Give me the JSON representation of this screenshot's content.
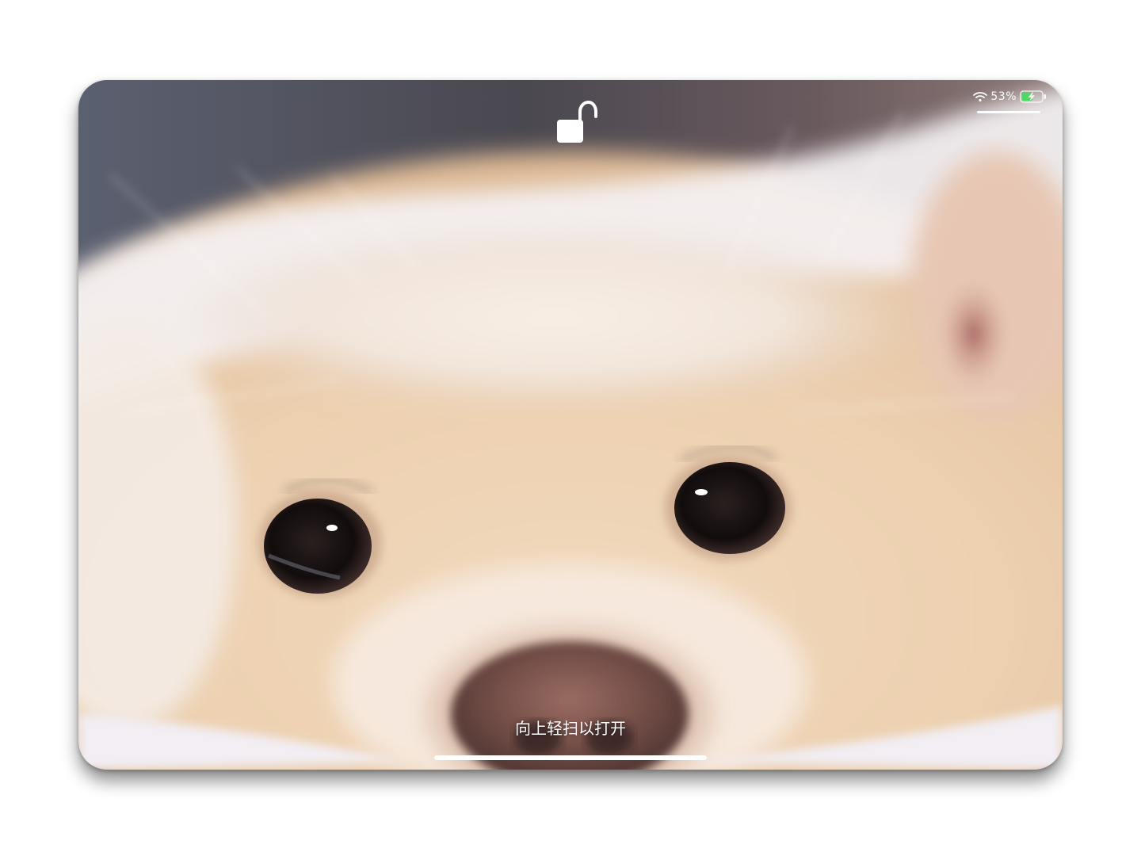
{
  "lock_screen": {
    "wallpaper_icon": "dog-photo-wallpaper",
    "lock_icon": "unlocked-padlock-icon",
    "unlock_hint": "向上轻扫以打开"
  },
  "status_bar": {
    "wifi_icon": "wifi-icon",
    "battery_percent": "53%",
    "battery_icon": "battery-charging-icon",
    "battery_level": 0.53,
    "battery_color": "#4cd964"
  },
  "colors": {
    "text": "#ffffff",
    "indicator": "#ffffff"
  }
}
